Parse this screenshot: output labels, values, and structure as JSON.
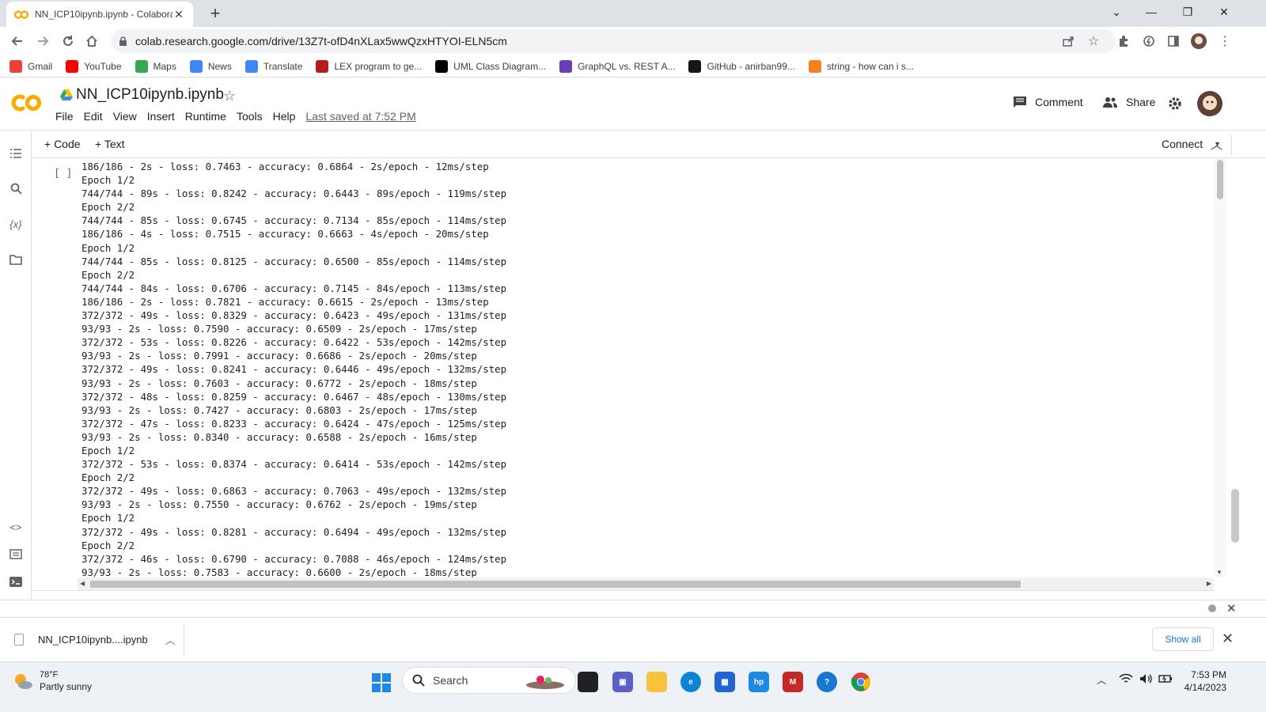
{
  "browser": {
    "tab_title": "NN_ICP10ipynb.ipynb - Colabora",
    "url": "colab.research.google.com/drive/13Z7t-ofD4nXLax5wwQzxHTYOI-ELN5cm",
    "bookmarks": [
      {
        "label": "Gmail",
        "icon": "gmail-icon",
        "color": "#ea4335"
      },
      {
        "label": "YouTube",
        "icon": "youtube-icon",
        "color": "#ff0000"
      },
      {
        "label": "Maps",
        "icon": "maps-icon",
        "color": "#34a853"
      },
      {
        "label": "News",
        "icon": "news-icon",
        "color": "#4285f4"
      },
      {
        "label": "Translate",
        "icon": "translate-icon",
        "color": "#4285f4"
      },
      {
        "label": "LEX program to ge...",
        "icon": "lex-icon",
        "color": "#b71c1c"
      },
      {
        "label": "UML Class Diagram...",
        "icon": "medium-icon",
        "color": "#000000"
      },
      {
        "label": "GraphQL vs. REST A...",
        "icon": "graphql-icon",
        "color": "#6a3fb5"
      },
      {
        "label": "GitHub - anirban99...",
        "icon": "github-icon",
        "color": "#181717"
      },
      {
        "label": "string - how can i s...",
        "icon": "stackoverflow-icon",
        "color": "#f48024"
      }
    ]
  },
  "colab": {
    "notebook_title": "NN_ICP10ipynb.ipynb",
    "menu": [
      "File",
      "Edit",
      "View",
      "Insert",
      "Runtime",
      "Tools",
      "Help"
    ],
    "last_saved": "Last saved at 7:52 PM",
    "comment_label": "Comment",
    "share_label": "Share",
    "add_code": "+ Code",
    "add_text": "+ Text",
    "connect_label": "Connect",
    "run_marker": "[ ]",
    "accent_color": "#f9ab00"
  },
  "output_lines": [
    "186/186 - 2s - loss: 0.7463 - accuracy: 0.6864 - 2s/epoch - 12ms/step",
    "Epoch 1/2",
    "744/744 - 89s - loss: 0.8242 - accuracy: 0.6443 - 89s/epoch - 119ms/step",
    "Epoch 2/2",
    "744/744 - 85s - loss: 0.6745 - accuracy: 0.7134 - 85s/epoch - 114ms/step",
    "186/186 - 4s - loss: 0.7515 - accuracy: 0.6663 - 4s/epoch - 20ms/step",
    "Epoch 1/2",
    "744/744 - 85s - loss: 0.8125 - accuracy: 0.6500 - 85s/epoch - 114ms/step",
    "Epoch 2/2",
    "744/744 - 84s - loss: 0.6706 - accuracy: 0.7145 - 84s/epoch - 113ms/step",
    "186/186 - 2s - loss: 0.7821 - accuracy: 0.6615 - 2s/epoch - 13ms/step",
    "372/372 - 49s - loss: 0.8329 - accuracy: 0.6423 - 49s/epoch - 131ms/step",
    "93/93 - 2s - loss: 0.7590 - accuracy: 0.6509 - 2s/epoch - 17ms/step",
    "372/372 - 53s - loss: 0.8226 - accuracy: 0.6422 - 53s/epoch - 142ms/step",
    "93/93 - 2s - loss: 0.7991 - accuracy: 0.6686 - 2s/epoch - 20ms/step",
    "372/372 - 49s - loss: 0.8241 - accuracy: 0.6446 - 49s/epoch - 132ms/step",
    "93/93 - 2s - loss: 0.7603 - accuracy: 0.6772 - 2s/epoch - 18ms/step",
    "372/372 - 48s - loss: 0.8259 - accuracy: 0.6467 - 48s/epoch - 130ms/step",
    "93/93 - 2s - loss: 0.7427 - accuracy: 0.6803 - 2s/epoch - 17ms/step",
    "372/372 - 47s - loss: 0.8233 - accuracy: 0.6424 - 47s/epoch - 125ms/step",
    "93/93 - 2s - loss: 0.8340 - accuracy: 0.6588 - 2s/epoch - 16ms/step",
    "Epoch 1/2",
    "372/372 - 53s - loss: 0.8374 - accuracy: 0.6414 - 53s/epoch - 142ms/step",
    "Epoch 2/2",
    "372/372 - 49s - loss: 0.6863 - accuracy: 0.7063 - 49s/epoch - 132ms/step",
    "93/93 - 2s - loss: 0.7550 - accuracy: 0.6762 - 2s/epoch - 19ms/step",
    "Epoch 1/2",
    "372/372 - 49s - loss: 0.8281 - accuracy: 0.6494 - 49s/epoch - 132ms/step",
    "Epoch 2/2",
    "372/372 - 46s - loss: 0.6790 - accuracy: 0.7088 - 46s/epoch - 124ms/step",
    "93/93 - 2s - loss: 0.7583 - accuracy: 0.6600 - 2s/epoch - 18ms/step"
  ],
  "downloads": {
    "file_name": "NN_ICP10ipynb....ipynb",
    "show_all": "Show all"
  },
  "taskbar": {
    "temperature": "78°F",
    "weather": "Partly sunny",
    "search_placeholder": "Search",
    "time": "7:53 PM",
    "date": "4/14/2023"
  }
}
